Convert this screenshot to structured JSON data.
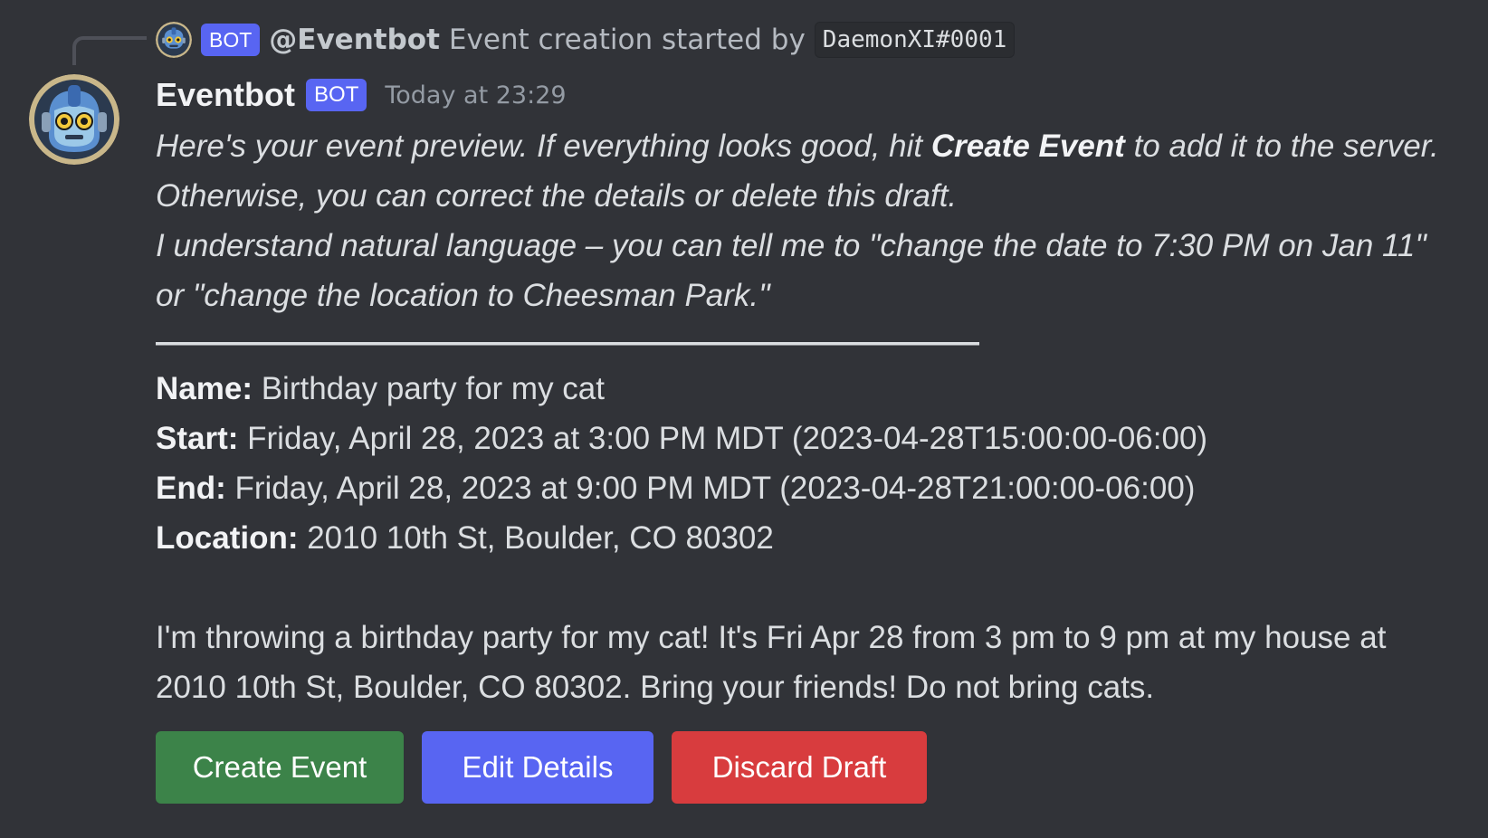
{
  "reply": {
    "bot_tag": "BOT",
    "author": "@Eventbot",
    "text": "Event creation started by",
    "user_code": "DaemonXI#0001"
  },
  "message": {
    "username": "Eventbot",
    "bot_tag": "BOT",
    "timestamp": "Today at 23:29",
    "intro_part1": "Here's your event preview. If everything looks good, hit ",
    "intro_bold": "Create Event",
    "intro_part2": " to add it to the server. Otherwise, you can correct the details or delete this draft.",
    "intro_line2": "I understand natural language – you can tell me to \"change the date to 7:30 PM on Jan 11\" or \"change the location to Cheesman Park.\"",
    "divider": "———————————————————————————————————————————",
    "fields": {
      "name_label": "Name:",
      "name_value": " Birthday party for my cat",
      "start_label": "Start:",
      "start_value": " Friday, April 28, 2023 at 3:00 PM MDT (2023-04-28T15:00:00-06:00)",
      "end_label": "End:",
      "end_value": " Friday, April 28, 2023 at 9:00 PM MDT (2023-04-28T21:00:00-06:00)",
      "location_label": "Location:",
      "location_value": " 2010 10th St, Boulder, CO 80302"
    },
    "description": "I'm throwing a birthday party for my cat! It's Fri Apr 28 from 3 pm to 9 pm at my house at 2010 10th St, Boulder, CO 80302. Bring your friends! Do not bring cats."
  },
  "buttons": {
    "create": "Create Event",
    "edit": "Edit Details",
    "discard": "Discard Draft"
  },
  "colors": {
    "background": "#313338",
    "bot_tag": "#5865f2",
    "create_button": "#3c8349",
    "edit_button": "#5865f2",
    "discard_button": "#d83c3e"
  },
  "icons": {
    "avatar": "robot-avatar-icon"
  }
}
